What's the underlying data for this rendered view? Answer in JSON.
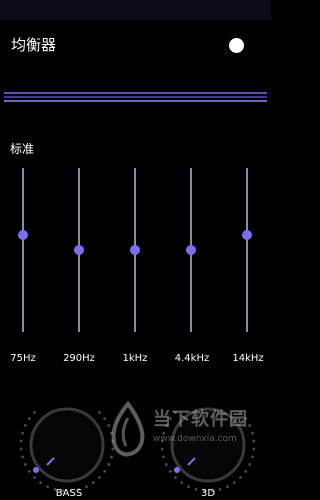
{
  "header": {
    "title": "均衡器",
    "enabled": true
  },
  "preset": {
    "label": "标准"
  },
  "bands": [
    {
      "label": "75Hz",
      "level": 0.59
    },
    {
      "label": "290Hz",
      "level": 0.5
    },
    {
      "label": "1kHz",
      "level": 0.5
    },
    {
      "label": "4.4kHz",
      "level": 0.5
    },
    {
      "label": "14kHz",
      "level": 0.59
    }
  ],
  "knobs": {
    "bass": {
      "label": "BASS",
      "level": 0.0
    },
    "virtualizer": {
      "label": "3D",
      "level": 0.0
    }
  },
  "watermark": {
    "text": "当下软件园",
    "url": "www.downxia.com"
  },
  "colors": {
    "accent": "#7b6ff0",
    "track": "#8c88a8",
    "background": "#000000",
    "spectrum": "#4f4aa8"
  }
}
